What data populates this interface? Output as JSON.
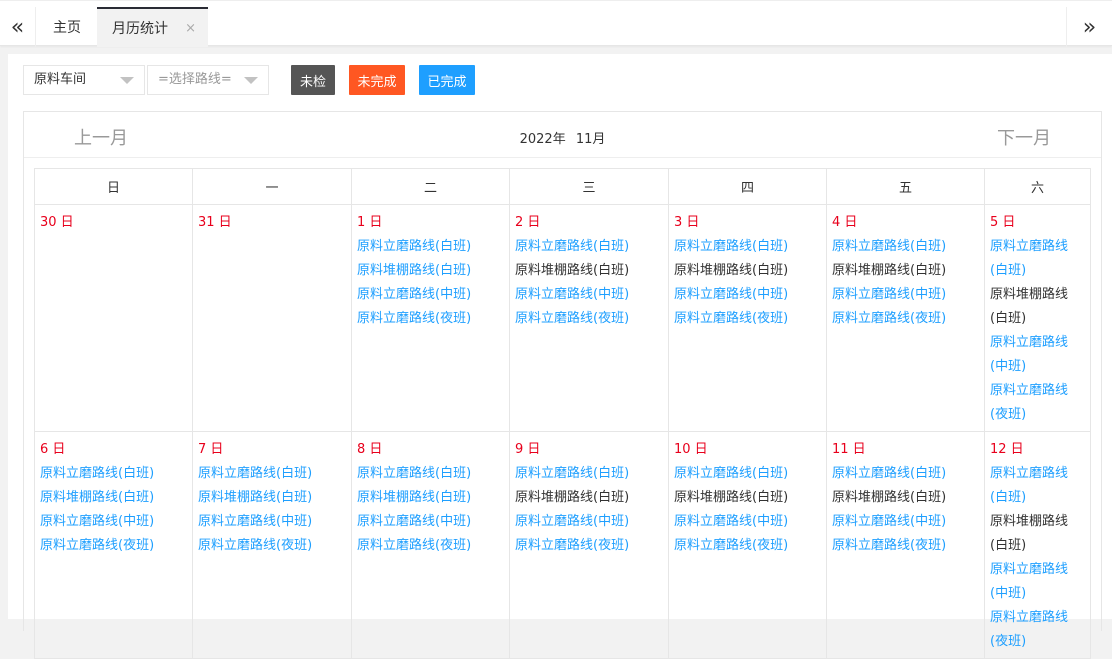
{
  "topbar": {
    "prev_icon": "«",
    "next_icon": "»",
    "home_tab": "主页",
    "active_tab": "月历统计",
    "close_icon": "×"
  },
  "filters": {
    "workshop": "原料车间",
    "route_placeholder": "=选择路线="
  },
  "legend": {
    "unchecked": "未检",
    "incomplete": "未完成",
    "complete": "已完成"
  },
  "colors": {
    "unchecked": "#555555",
    "incomplete": "#ff5722",
    "complete": "#1e9fff",
    "day_number": "#e8001c"
  },
  "calendar": {
    "prev_label": "上一月",
    "next_label": "下一月",
    "year": "2022年",
    "month": "11月",
    "weekdays": [
      "日",
      "一",
      "二",
      "三",
      "四",
      "五",
      "六"
    ],
    "weeks": [
      [
        {
          "day": "30 日",
          "items": []
        },
        {
          "day": "31 日",
          "items": []
        },
        {
          "day": "1 日",
          "items": [
            {
              "text": "原料立磨路线(白班)",
              "status": "done"
            },
            {
              "text": "原料堆棚路线(白班)",
              "status": "done"
            },
            {
              "text": "原料立磨路线(中班)",
              "status": "done"
            },
            {
              "text": "原料立磨路线(夜班)",
              "status": "done"
            }
          ]
        },
        {
          "day": "2 日",
          "items": [
            {
              "text": "原料立磨路线(白班)",
              "status": "done"
            },
            {
              "text": "原料堆棚路线(白班)",
              "status": "pending"
            },
            {
              "text": "原料立磨路线(中班)",
              "status": "done"
            },
            {
              "text": "原料立磨路线(夜班)",
              "status": "done"
            }
          ]
        },
        {
          "day": "3 日",
          "items": [
            {
              "text": "原料立磨路线(白班)",
              "status": "done"
            },
            {
              "text": "原料堆棚路线(白班)",
              "status": "pending"
            },
            {
              "text": "原料立磨路线(中班)",
              "status": "done"
            },
            {
              "text": "原料立磨路线(夜班)",
              "status": "done"
            }
          ]
        },
        {
          "day": "4 日",
          "items": [
            {
              "text": "原料立磨路线(白班)",
              "status": "done"
            },
            {
              "text": "原料堆棚路线(白班)",
              "status": "pending"
            },
            {
              "text": "原料立磨路线(中班)",
              "status": "done"
            },
            {
              "text": "原料立磨路线(夜班)",
              "status": "done"
            }
          ]
        },
        {
          "day": "5 日",
          "items": [
            {
              "text": "原料立磨路线(白班)",
              "status": "done"
            },
            {
              "text": "原料堆棚路线(白班)",
              "status": "pending"
            },
            {
              "text": "原料立磨路线(中班)",
              "status": "done"
            },
            {
              "text": "原料立磨路线(夜班)",
              "status": "done"
            }
          ]
        }
      ],
      [
        {
          "day": "6 日",
          "items": [
            {
              "text": "原料立磨路线(白班)",
              "status": "done"
            },
            {
              "text": "原料堆棚路线(白班)",
              "status": "done"
            },
            {
              "text": "原料立磨路线(中班)",
              "status": "done"
            },
            {
              "text": "原料立磨路线(夜班)",
              "status": "done"
            }
          ]
        },
        {
          "day": "7 日",
          "items": [
            {
              "text": "原料立磨路线(白班)",
              "status": "done"
            },
            {
              "text": "原料堆棚路线(白班)",
              "status": "done"
            },
            {
              "text": "原料立磨路线(中班)",
              "status": "done"
            },
            {
              "text": "原料立磨路线(夜班)",
              "status": "done"
            }
          ]
        },
        {
          "day": "8 日",
          "items": [
            {
              "text": "原料立磨路线(白班)",
              "status": "done"
            },
            {
              "text": "原料堆棚路线(白班)",
              "status": "done"
            },
            {
              "text": "原料立磨路线(中班)",
              "status": "done"
            },
            {
              "text": "原料立磨路线(夜班)",
              "status": "done"
            }
          ]
        },
        {
          "day": "9 日",
          "items": [
            {
              "text": "原料立磨路线(白班)",
              "status": "done"
            },
            {
              "text": "原料堆棚路线(白班)",
              "status": "pending"
            },
            {
              "text": "原料立磨路线(中班)",
              "status": "done"
            },
            {
              "text": "原料立磨路线(夜班)",
              "status": "done"
            }
          ]
        },
        {
          "day": "10 日",
          "items": [
            {
              "text": "原料立磨路线(白班)",
              "status": "done"
            },
            {
              "text": "原料堆棚路线(白班)",
              "status": "pending"
            },
            {
              "text": "原料立磨路线(中班)",
              "status": "done"
            },
            {
              "text": "原料立磨路线(夜班)",
              "status": "done"
            }
          ]
        },
        {
          "day": "11 日",
          "items": [
            {
              "text": "原料立磨路线(白班)",
              "status": "done"
            },
            {
              "text": "原料堆棚路线(白班)",
              "status": "pending"
            },
            {
              "text": "原料立磨路线(中班)",
              "status": "done"
            },
            {
              "text": "原料立磨路线(夜班)",
              "status": "done"
            }
          ]
        },
        {
          "day": "12 日",
          "items": [
            {
              "text": "原料立磨路线(白班)",
              "status": "done"
            },
            {
              "text": "原料堆棚路线(白班)",
              "status": "pending"
            },
            {
              "text": "原料立磨路线(中班)",
              "status": "done"
            },
            {
              "text": "原料立磨路线(夜班)",
              "status": "done"
            }
          ]
        }
      ]
    ]
  }
}
